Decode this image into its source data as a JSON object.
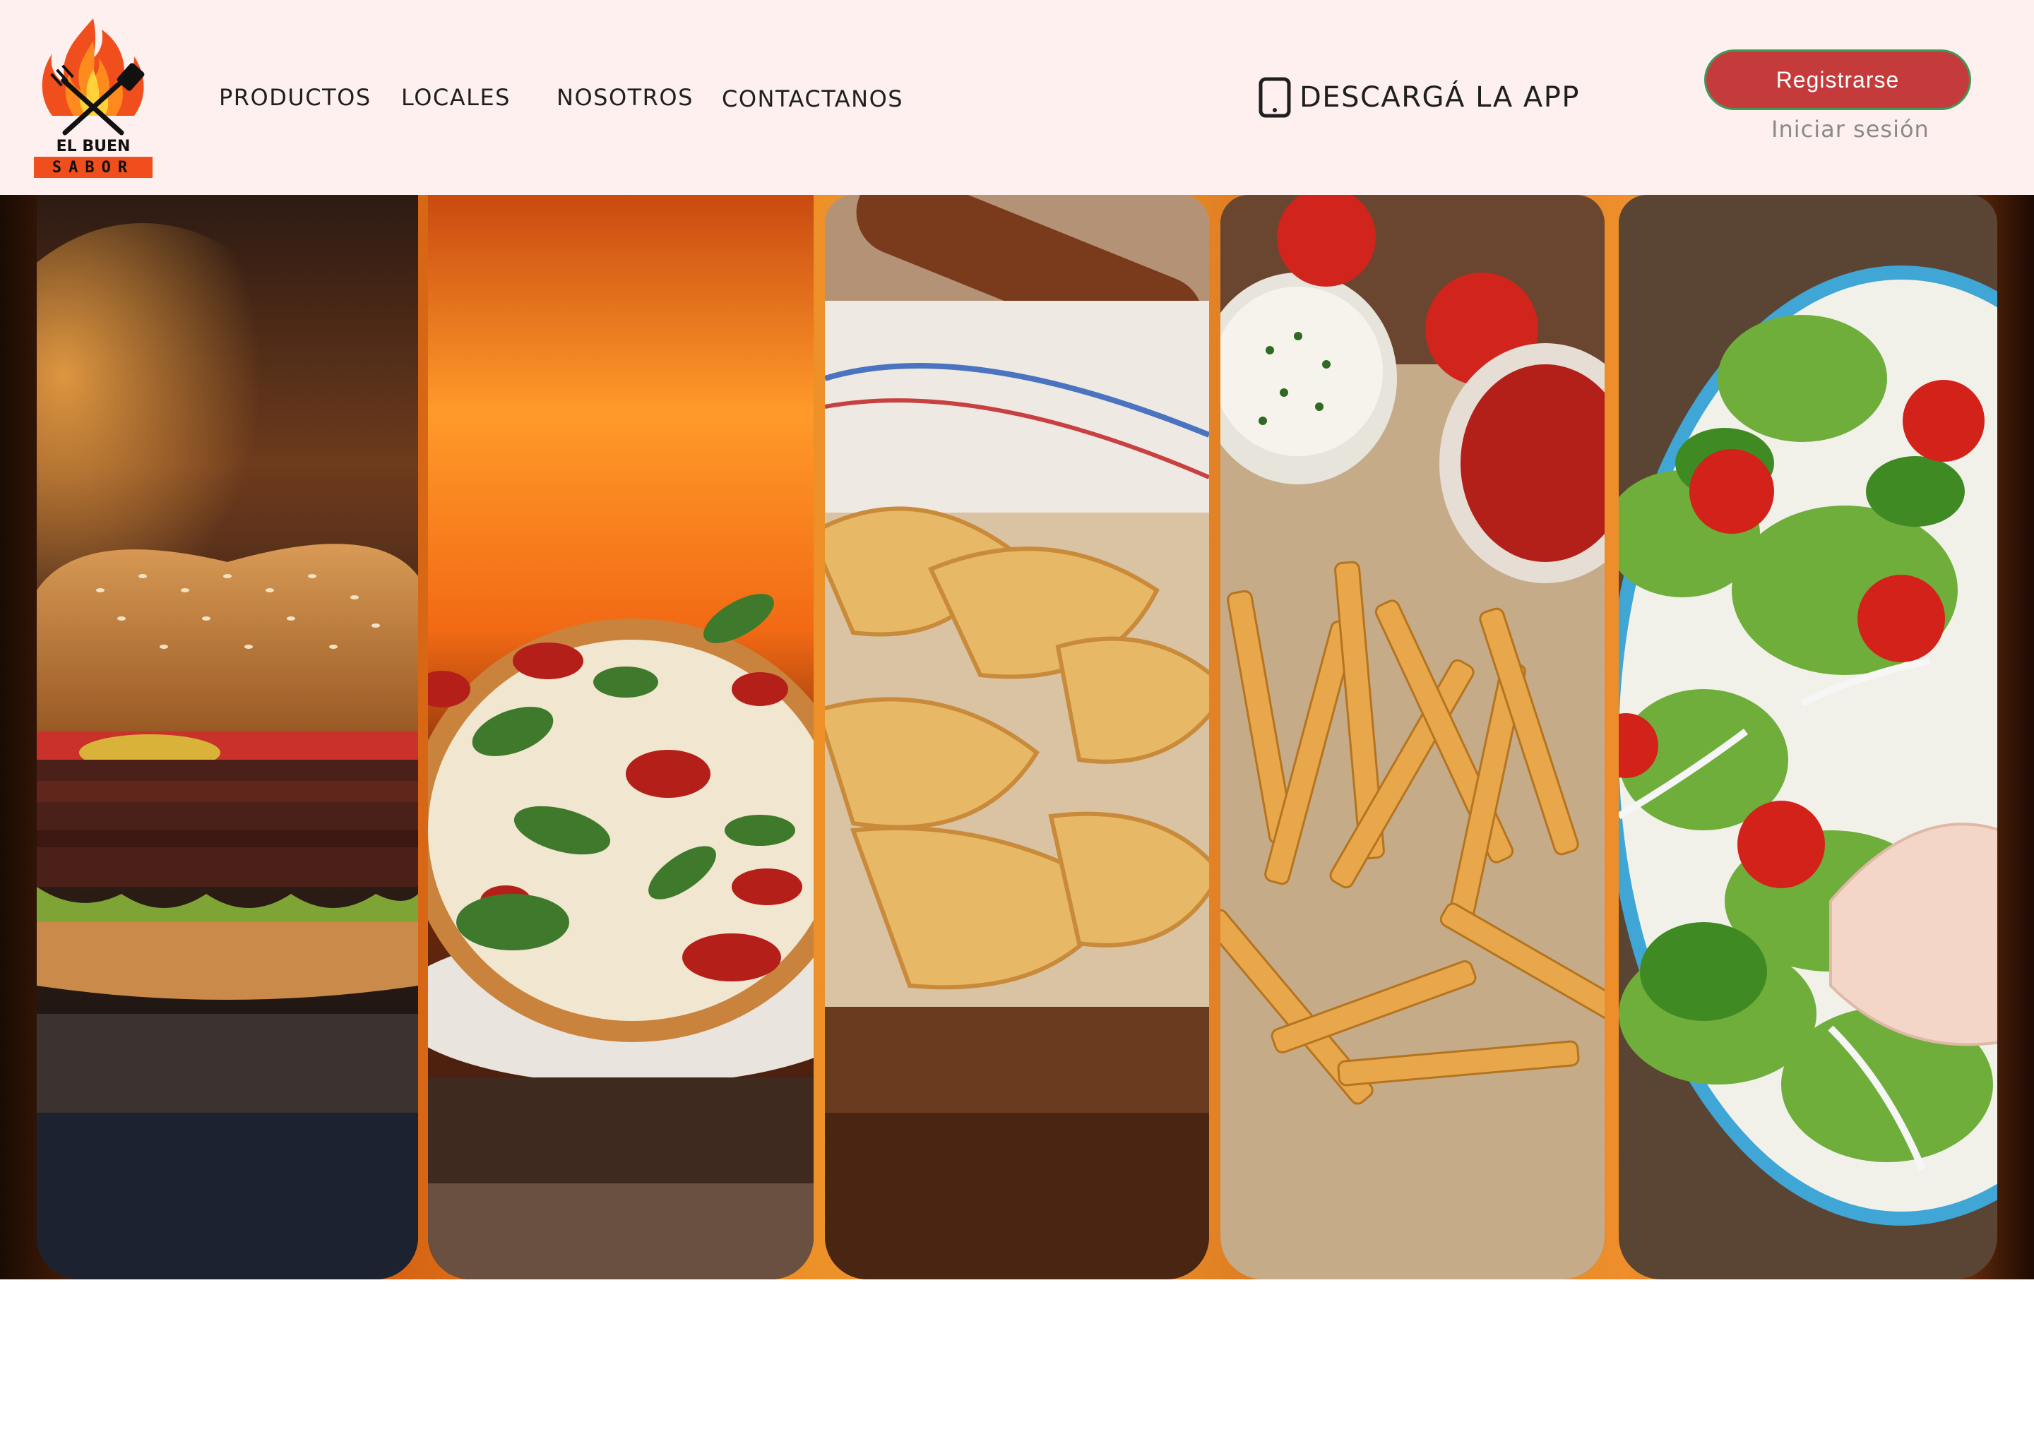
{
  "brand": {
    "logo_line1": "EL BUEN",
    "logo_line2": "SABOR",
    "logo_icon": "flame-grill-icon"
  },
  "nav": {
    "items": [
      {
        "label": "PRODUCTOS"
      },
      {
        "label": "LOCALES"
      },
      {
        "label": "NOSOTROS"
      },
      {
        "label": "CONTACTANOS"
      }
    ]
  },
  "app": {
    "label": "DESCARGÁ LA APP",
    "icon": "smartphone-icon"
  },
  "auth": {
    "register_label": "Registrarse",
    "login_label": "Iniciar sesión"
  },
  "hero": {
    "panels": [
      {
        "image": "burger"
      },
      {
        "image": "pizza"
      },
      {
        "image": "empanadas"
      },
      {
        "image": "fries"
      },
      {
        "image": "salad"
      }
    ]
  },
  "colors": {
    "header_bg": "#fdf0ef",
    "accent_red": "#c53b3b",
    "button_border": "#3f9a5a",
    "hero_glow": "#ea8a22"
  }
}
